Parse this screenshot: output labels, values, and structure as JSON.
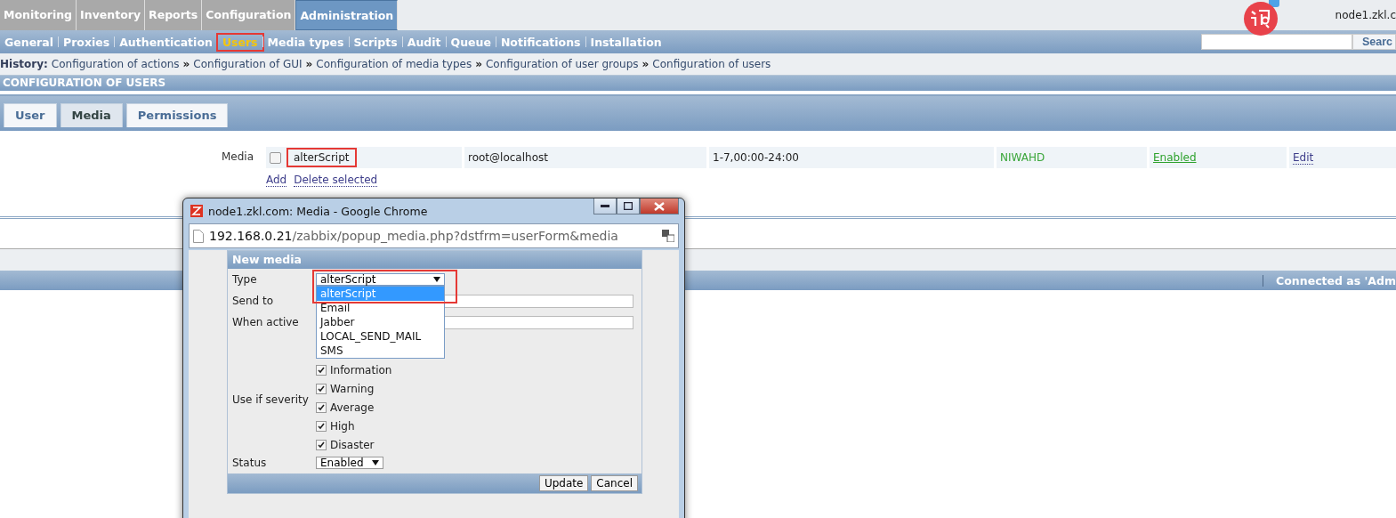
{
  "main_menu": [
    {
      "label": "Monitoring",
      "selected": false
    },
    {
      "label": "Inventory",
      "selected": false
    },
    {
      "label": "Reports",
      "selected": false
    },
    {
      "label": "Configuration",
      "selected": false
    },
    {
      "label": "Administration",
      "selected": true
    }
  ],
  "host_label": "node1.zkl.c",
  "sub_menu": [
    {
      "label": "General",
      "selected": false,
      "highlighted": false
    },
    {
      "label": "Proxies",
      "selected": false,
      "highlighted": false
    },
    {
      "label": "Authentication",
      "selected": false,
      "highlighted": false
    },
    {
      "label": "Users",
      "selected": true,
      "highlighted": true
    },
    {
      "label": "Media types",
      "selected": false,
      "highlighted": false
    },
    {
      "label": "Scripts",
      "selected": false,
      "highlighted": false
    },
    {
      "label": "Audit",
      "selected": false,
      "highlighted": false
    },
    {
      "label": "Queue",
      "selected": false,
      "highlighted": false
    },
    {
      "label": "Notifications",
      "selected": false,
      "highlighted": false
    },
    {
      "label": "Installation",
      "selected": false,
      "highlighted": false
    }
  ],
  "search": {
    "button": "Searc"
  },
  "history": {
    "label": "History:",
    "items": [
      "Configuration of actions",
      "Configuration of GUI",
      "Configuration of media types",
      "Configuration of user groups",
      "Configuration of users"
    ],
    "separator": "»"
  },
  "section_title": "CONFIGURATION OF USERS",
  "form_tabs": [
    {
      "label": "User",
      "selected": false
    },
    {
      "label": "Media",
      "selected": true
    },
    {
      "label": "Permissions",
      "selected": false
    }
  ],
  "media": {
    "label": "Media",
    "rows": [
      {
        "checked": false,
        "type": "alterScript",
        "highlighted": true,
        "send_to": "root@localhost",
        "when_active": "1-7,00:00-24:00",
        "severity": "NIWAHD",
        "status": "Enabled",
        "action": "Edit"
      }
    ],
    "links": [
      "Add",
      "Delete selected"
    ]
  },
  "footer": {
    "text": "Connected as 'Adm"
  },
  "popup": {
    "title": "node1.zkl.com: Media - Google Chrome",
    "url_host": "192.168.0.21",
    "url_path": "/zabbix/popup_media.php?dstfrm=userForm&media",
    "form_title": "New media",
    "type_label": "Type",
    "type_value": "alterScript",
    "type_highlighted": true,
    "type_options": [
      {
        "label": "alterScript",
        "selected": true
      },
      {
        "label": "Email",
        "selected": false
      },
      {
        "label": "Jabber",
        "selected": false
      },
      {
        "label": "LOCAL_SEND_MAIL",
        "selected": false
      },
      {
        "label": "SMS",
        "selected": false
      }
    ],
    "send_to_label": "Send to",
    "when_active_label": "When active",
    "severity_label": "Use if severity",
    "severities": [
      {
        "label": "Information",
        "checked": true
      },
      {
        "label": "Warning",
        "checked": true
      },
      {
        "label": "Average",
        "checked": true
      },
      {
        "label": "High",
        "checked": true
      },
      {
        "label": "Disaster",
        "checked": true
      }
    ],
    "status_label": "Status",
    "status_value": "Enabled",
    "buttons": [
      "Update",
      "Cancel"
    ]
  }
}
